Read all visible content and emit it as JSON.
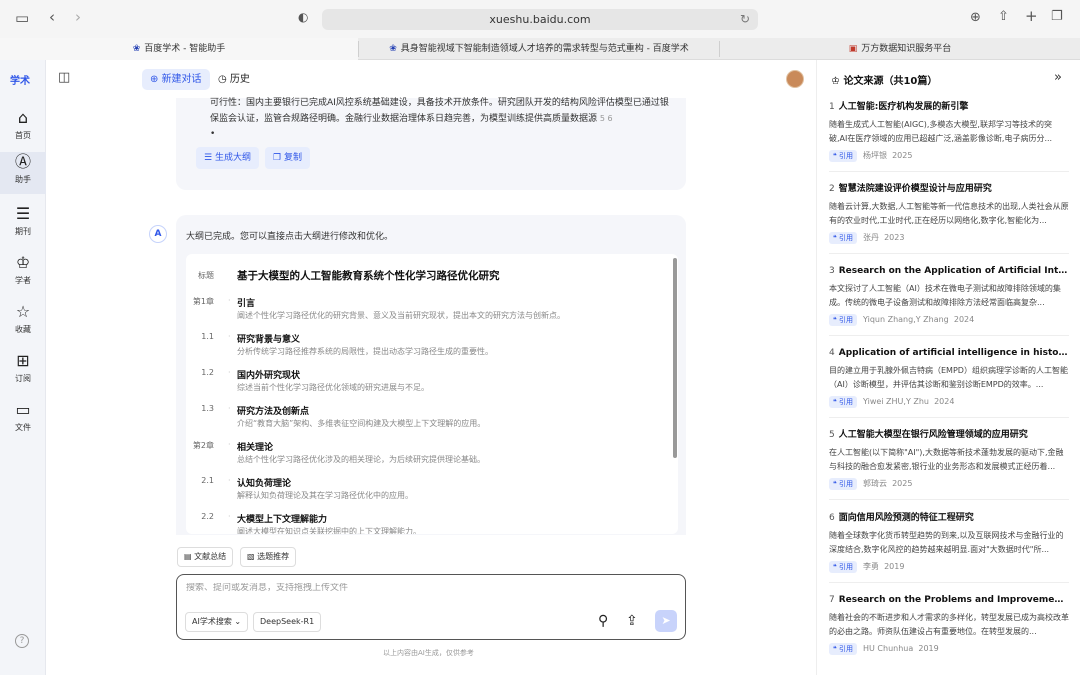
{
  "browser": {
    "url": "xueshu.baidu.com",
    "tabs": [
      {
        "label": "百度学术 - 智能助手"
      },
      {
        "label": "具身智能视域下智能制造领域人才培养的需求转型与范式重构 - 百度学术"
      },
      {
        "label": "万方数据知识服务平台"
      }
    ]
  },
  "sidebar": {
    "logo": "学术",
    "items": [
      {
        "label": "首页"
      },
      {
        "label": "助手"
      },
      {
        "label": "期刊"
      },
      {
        "label": "学者"
      },
      {
        "label": "收藏"
      },
      {
        "label": "订阅"
      },
      {
        "label": "文件"
      }
    ]
  },
  "toolbar": {
    "new_chat": "新建对话",
    "history": "历史"
  },
  "chat": {
    "prev_text": "可行性：国内主要银行已完成AI风控系统基础建设，具备技术开放条件。研究团队开发的结构风险评估模型已通过银保监会认证，监管合规路径明确。金融行业数据治理体系日趋完善，为模型训练提供高质量数据源",
    "prev_refs": "5   6",
    "prev_dot": "•",
    "gen_outline": "生成大纲",
    "copy": "复制",
    "ai_badge": "A",
    "intro": "大纲已完成。您可以直接点击大纲进行修改和优化。",
    "outline": [
      {
        "num": "标题",
        "title": "基于大模型的人工智能教育系统个性化学习路径优化研究",
        "desc": ""
      },
      {
        "num": "第1章",
        "title": "引言",
        "desc": "阐述个性化学习路径优化的研究背景、意义及当前研究现状，提出本文的研究方法与创新点。"
      },
      {
        "num": "1.1",
        "title": "研究背景与意义",
        "desc": "分析传统学习路径推荐系统的局限性，提出动态学习路径生成的重要性。"
      },
      {
        "num": "1.2",
        "title": "国内外研究现状",
        "desc": "综述当前个性化学习路径优化领域的研究进展与不足。"
      },
      {
        "num": "1.3",
        "title": "研究方法及创新点",
        "desc": "介绍“教育大脑”架构、多维表征空间构建及大模型上下文理解的应用。"
      },
      {
        "num": "第2章",
        "title": "相关理论",
        "desc": "总结个性化学习路径优化涉及的相关理论，为后续研究提供理论基础。"
      },
      {
        "num": "2.1",
        "title": "认知负荷理论",
        "desc": "解释认知负荷理论及其在学习路径优化中的应用。"
      },
      {
        "num": "2.2",
        "title": "大模型上下文理解能力",
        "desc": "阐述大模型在知识点关联挖掘中的上下文理解能力。"
      }
    ],
    "tools": [
      {
        "label": "文献总结"
      },
      {
        "label": "选题推荐"
      }
    ],
    "input_placeholder": "搜索、提问或发消息，支持拖拽上传文件",
    "mode_select": "AI学术搜索",
    "model": "DeepSeek-R1",
    "disclaimer": "以上内容由AI生成，仅供参考"
  },
  "sources": {
    "header": "论文来源（共10篇）",
    "cite_label": "引用",
    "items": [
      {
        "num": "1",
        "title": "人工智能:医疗机构发展的新引擎",
        "abstract": "随着生成式人工智能(AIGC),多模态大模型,联邦学习等技术的突破,AI在医疗领域的应用已超越广泛,涵盖影像诊断,电子病历分...",
        "authors": "杨坪银",
        "year": "2025"
      },
      {
        "num": "2",
        "title": "智慧法院建设评价模型设计与应用研究",
        "abstract": "随着云计算,大数据,人工智能等新一代信息技术的出现,人类社会从原有的农业时代,工业时代,正在经历以网络化,数字化,智能化为...",
        "authors": "张丹",
        "year": "2023"
      },
      {
        "num": "3",
        "title": "Research on the Application of Artificial Intelligence",
        "abstract": "本文探讨了人工智能（AI）技术在微电子测试和故障排除领域的集成。传统的微电子设备测试和故障排除方法经常面临高复杂...",
        "authors": "Yiqun Zhang,Y Zhang",
        "year": "2024"
      },
      {
        "num": "4",
        "title": "Application of artificial intelligence in histopathology",
        "abstract": "目的建立用于乳腺外佩吉特病（EMPD）组织病理学诊断的人工智能（AI）诊断模型，并评估其诊断和鉴别诊断EMPD的效率。...",
        "authors": "Yiwei ZHU,Y Zhu",
        "year": "2024"
      },
      {
        "num": "5",
        "title": "人工智能大模型在银行风险管理领域的应用研究",
        "abstract": "在人工智能(以下简称\"AI\"),大数据等新技术蓬勃发展的驱动下,金融与科技的融合愈发紧密,银行业的业务形态和发展模式正经历着...",
        "authors": "郭琦云",
        "year": "2025"
      },
      {
        "num": "6",
        "title": "面向信用风险预测的特征工程研究",
        "abstract": "随着全球数字化货币转型趋势的到来,以及互联网技术与金融行业的深度结合,数字化风控的趋势越来越明显.面对\"大数据时代\"所...",
        "authors": "李勇",
        "year": "2019"
      },
      {
        "num": "7",
        "title": "Research on the Problems and Improvement Strategies",
        "abstract": "随着社会的不断进步和人才需求的多样化，转型发展已成为高校改革的必由之路。师资队伍建设占有重要地位。在转型发展的...",
        "authors": "HU Chunhua",
        "year": "2019"
      }
    ]
  }
}
